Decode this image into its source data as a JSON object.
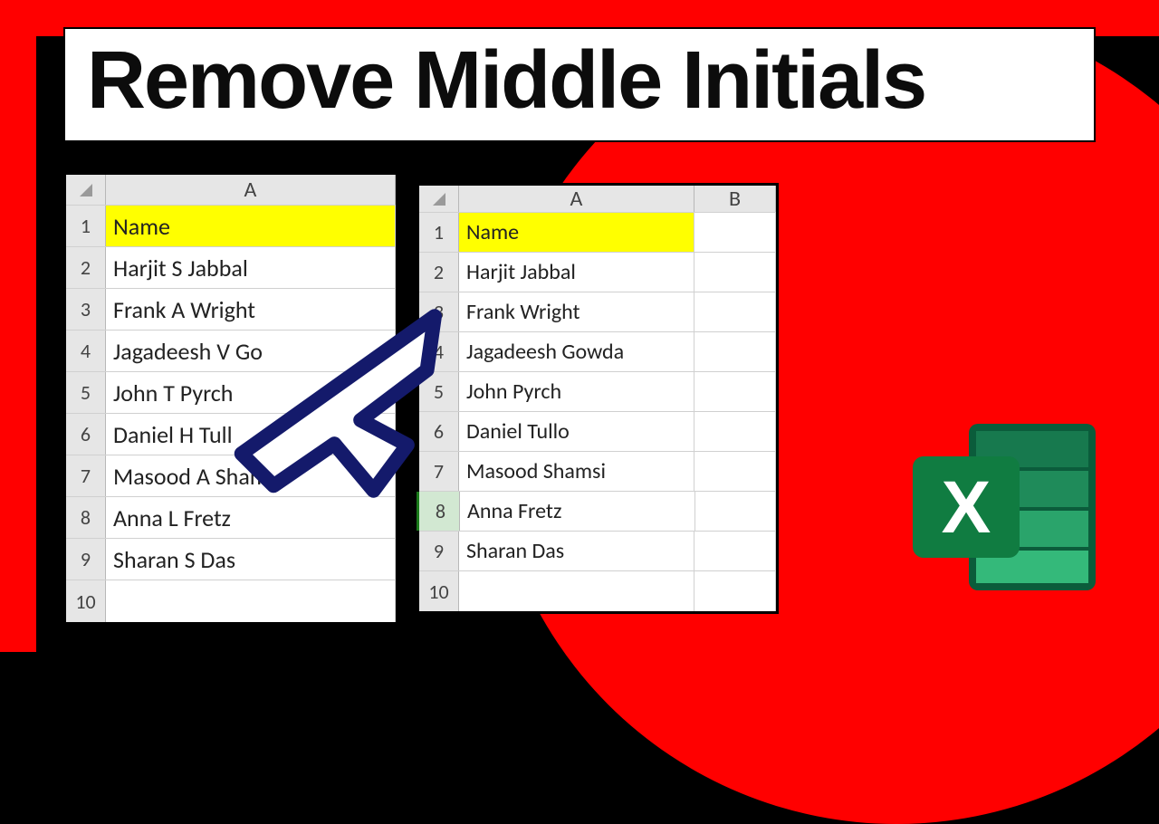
{
  "title": "Remove Middle Initials",
  "left_sheet": {
    "col_header": "A",
    "header_label": "Name",
    "rows": [
      "Harjit S Jabbal",
      "Frank A Wright",
      "Jagadeesh V Go",
      "John T Pyrch",
      "Daniel H Tull",
      "Masood A Shamsi",
      "Anna L Fretz",
      "Sharan S Das"
    ]
  },
  "right_sheet": {
    "col_headers": [
      "A",
      "B"
    ],
    "header_label": "Name",
    "rows": [
      "Harjit Jabbal",
      "Frank Wright",
      "Jagadeesh Gowda",
      "John Pyrch",
      "Daniel Tullo",
      "Masood Shamsi",
      "Anna Fretz",
      "Sharan Das"
    ],
    "selected_row_index": 7
  },
  "row_numbers": [
    "1",
    "2",
    "3",
    "4",
    "5",
    "6",
    "7",
    "8",
    "9",
    "10"
  ],
  "chart_data": {
    "type": "table",
    "title": "Remove Middle Initials",
    "before": {
      "columns": [
        "Name"
      ],
      "rows": [
        [
          "Harjit S Jabbal"
        ],
        [
          "Frank A Wright"
        ],
        [
          "Jagadeesh V Gowda"
        ],
        [
          "John T Pyrch"
        ],
        [
          "Daniel H Tullo"
        ],
        [
          "Masood A Shamsi"
        ],
        [
          "Anna L Fretz"
        ],
        [
          "Sharan S Das"
        ]
      ]
    },
    "after": {
      "columns": [
        "Name"
      ],
      "rows": [
        [
          "Harjit Jabbal"
        ],
        [
          "Frank Wright"
        ],
        [
          "Jagadeesh Gowda"
        ],
        [
          "John Pyrch"
        ],
        [
          "Daniel Tullo"
        ],
        [
          "Masood Shamsi"
        ],
        [
          "Anna Fretz"
        ],
        [
          "Sharan Das"
        ]
      ]
    }
  }
}
